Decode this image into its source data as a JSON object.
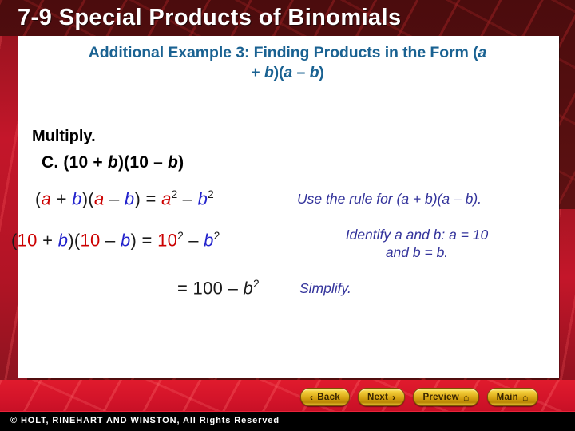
{
  "slide": {
    "lesson_number": "7-9",
    "title": "7-9  Special Products of Binomials",
    "subtitle_line1": "Additional Example 3: Finding Products in the Form (a",
    "subtitle_line2_pre": "+ ",
    "subtitle_line2": "+ b)(a – b)",
    "instruction": "Multiply.",
    "problem": "C. (10 + b)(10 – b)"
  },
  "equations": [
    {
      "id": "rule-row",
      "text": "(a + b)(a – b) = a2 – b2",
      "note": "Use the rule for (a + b)(a – b)."
    },
    {
      "id": "substitute-row",
      "text": "(10 + b)(10 – b) = 102 – b2",
      "note_line1": "Identify a and b: a = 10",
      "note_line2": "and b = b."
    },
    {
      "id": "simplify-row",
      "text": "= 100 – b2",
      "note": "Simplify."
    }
  ],
  "tokens": {
    "open_paren": "(",
    "close_paren": ")",
    "plus": "+",
    "minus": "–",
    "equals": "=",
    "a": "a",
    "b": "b",
    "ten": "10",
    "hundred": "100",
    "exp2": "2"
  },
  "nav": {
    "back_label": "Back",
    "next_label": "Next",
    "preview_label": "Preview",
    "main_label": "Main",
    "chevron_left": "‹",
    "chevron_right": "›",
    "home_glyph": "⌂"
  },
  "footer": {
    "copyright": "© HOLT, RINEHART AND WINSTON, All Rights Reserved"
  },
  "colors": {
    "title_bg": "#5d1112",
    "panel_bg": "#ffffff",
    "subtitle": "#1a6292",
    "variable_a": "#cc0000",
    "variable_b": "#2222cc",
    "note_text": "#33339b",
    "red_band": "#d4142a",
    "button_gold": "#d8a513"
  }
}
